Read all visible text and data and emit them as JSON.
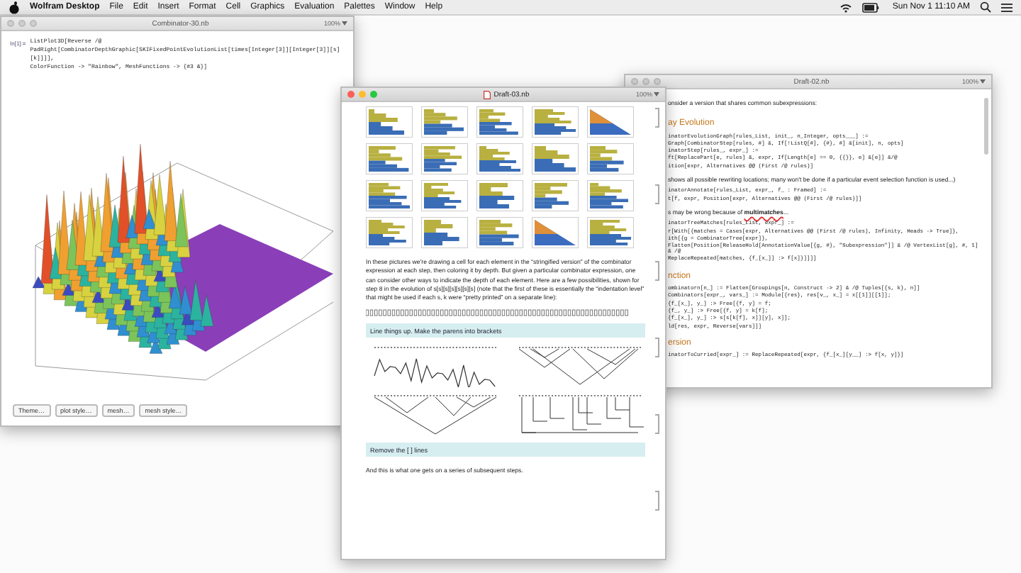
{
  "menu_bar": {
    "app": "Wolfram Desktop",
    "menus": [
      "File",
      "Edit",
      "Insert",
      "Format",
      "Cell",
      "Graphics",
      "Evaluation",
      "Palettes",
      "Window",
      "Help"
    ],
    "clock": "Sun Nov 1 11:10 AM"
  },
  "windows": [
    {
      "kind": "plot",
      "title": "Combinator-30.nb",
      "active": false,
      "zoom": "100%",
      "input_label": "In[1]:=",
      "code": [
        "ListPlot3D[Reverse /@ PadRight[CombinatorDepthGraphic[SKIFixedPointEvolutionList[times[Integer[3]][Integer[3]][s][k]]]],",
        "ColorFunction -> \"Rainbow\", MeshFunctions -> {#3 &}]"
      ],
      "toolbar": [
        "Theme…",
        "plot style…",
        "mesh…",
        "mesh style…"
      ]
    },
    {
      "kind": "code",
      "title": "Draft-02.nb",
      "active": false,
      "zoom": "100%",
      "lines": [
        {
          "kind": "text",
          "text": "onsider a version that shares common subexpressions:"
        },
        {
          "kind": "heading",
          "text": "ay Evolution"
        },
        {
          "kind": "code",
          "text": "inatorEvolutionGraph[rules_List, init_, n_Integer, opts___] :="
        },
        {
          "kind": "code",
          "text": "Graph[CombinatorStep[rules, #] &, If[!ListQ[#], {#}, #] &[init], n, opts]"
        },
        {
          "kind": "code",
          "text": "inatorStep[rules_, expr_] :="
        },
        {
          "kind": "code",
          "text": "ft[ReplacePart[e, rules] &, expr, If[Length[e] == 0, {{}}, e] &[e]] &/@"
        },
        {
          "kind": "code",
          "text": "ition[expr, Alternatives @@ (First /@ rules)]"
        },
        {
          "kind": "text",
          "text": "shows all possible rewriting locations; many won't be done if a particular event selection function is used...)"
        },
        {
          "kind": "code",
          "text": "inatorAnnotate[rules_List, expr_, f_ : Framed] :="
        },
        {
          "kind": "code",
          "text": "t[f, expr, Position[expr, Alternatives @@ (First /@ rules)]]"
        },
        {
          "kind": "text",
          "text": "s may be wrong because of **multimatches**..."
        },
        {
          "kind": "code",
          "text": "inatorTreeMatches[rules_List, expr_] :="
        },
        {
          "kind": "code",
          "text": "r[With[{matches = Cases[expr, Alternatives @@ (First /@ rules), Infinity, Heads -> True]},"
        },
        {
          "kind": "code",
          "text": "ith[{g = CombinatorTree[expr]},"
        },
        {
          "kind": "code",
          "text": "Flatten[Position[ReleaseHold[AnnotationValue[{g, #}, \"Subexpression\"]] & /@ VertexList[g], #, 1] & /@"
        },
        {
          "kind": "code",
          "text": "  ReplaceRepeated[matches, {f_[x_]] :> f[x]}]]]]"
        },
        {
          "kind": "heading",
          "text": "nction"
        },
        {
          "kind": "code",
          "text": "ombinatorn[n_] := Flatten[Groupings[n, Construct -> 2] & /@ Tuples[{s, k}, n]]"
        },
        {
          "kind": "code",
          "text": "Combinators[expr_, vars_] := Module[{res}, res[v_, x_] = x[[1]][[1]];"
        },
        {
          "kind": "code",
          "text": "{f_[x_], y_] :> Free[{f, y] = f;"
        },
        {
          "kind": "code",
          "text": "{f_, y_] :> Free[{f, y] = k[f];"
        },
        {
          "kind": "code",
          "text": "{f_[x_], y_] :> s[s[k[f], x]][y], x]];"
        },
        {
          "kind": "code",
          "text": "ld[res, expr, Reverse[vars]]]"
        },
        {
          "kind": "heading",
          "text": "ersion"
        },
        {
          "kind": "code",
          "text": "inatorToCurried[expr_] := ReplaceRepeated[expr, {f_[x_][y__] :> f[x, y]}]"
        }
      ]
    },
    {
      "kind": "notebook",
      "title": "Draft-03.nb",
      "active": true,
      "zoom": "100%",
      "paragraph": "In these pictures we’re drawing a cell for each element in the “stringified version” of the combinator expression at each step, then coloring it by depth. But given a particular combinator expression, one can consider other ways to indicate the depth of each element. Here are a few possibilities, shown for step 8 in the evolution of s[s][s][s][s][s][s] (note that the first of these is essentially the “indentation level” that might be used if each s, k were “pretty printed” on a separate line):",
      "sections": [
        "Line things up. Make the parens into brackets",
        "Remove the [ ] lines"
      ],
      "closing": "And this is what one gets on a series of subsequent steps."
    }
  ]
}
